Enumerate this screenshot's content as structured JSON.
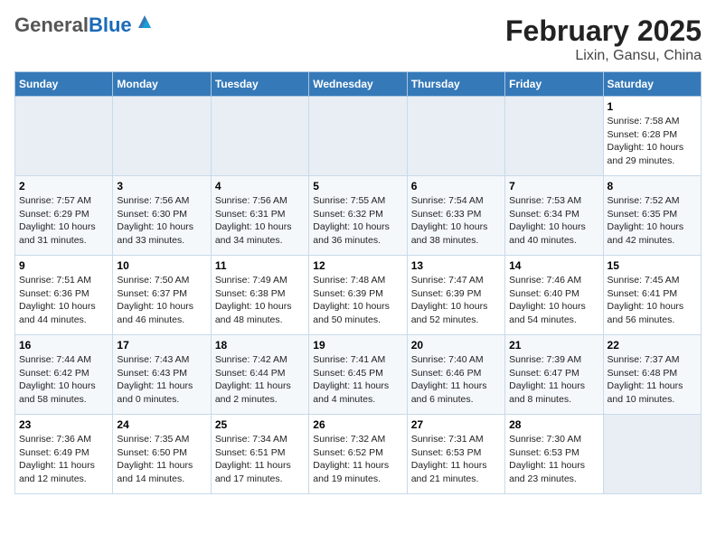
{
  "logo": {
    "general": "General",
    "blue": "Blue"
  },
  "title": "February 2025",
  "subtitle": "Lixin, Gansu, China",
  "days_of_week": [
    "Sunday",
    "Monday",
    "Tuesday",
    "Wednesday",
    "Thursday",
    "Friday",
    "Saturday"
  ],
  "weeks": [
    [
      {
        "day": "",
        "info": ""
      },
      {
        "day": "",
        "info": ""
      },
      {
        "day": "",
        "info": ""
      },
      {
        "day": "",
        "info": ""
      },
      {
        "day": "",
        "info": ""
      },
      {
        "day": "",
        "info": ""
      },
      {
        "day": "1",
        "info": "Sunrise: 7:58 AM\nSunset: 6:28 PM\nDaylight: 10 hours and 29 minutes."
      }
    ],
    [
      {
        "day": "2",
        "info": "Sunrise: 7:57 AM\nSunset: 6:29 PM\nDaylight: 10 hours and 31 minutes."
      },
      {
        "day": "3",
        "info": "Sunrise: 7:56 AM\nSunset: 6:30 PM\nDaylight: 10 hours and 33 minutes."
      },
      {
        "day": "4",
        "info": "Sunrise: 7:56 AM\nSunset: 6:31 PM\nDaylight: 10 hours and 34 minutes."
      },
      {
        "day": "5",
        "info": "Sunrise: 7:55 AM\nSunset: 6:32 PM\nDaylight: 10 hours and 36 minutes."
      },
      {
        "day": "6",
        "info": "Sunrise: 7:54 AM\nSunset: 6:33 PM\nDaylight: 10 hours and 38 minutes."
      },
      {
        "day": "7",
        "info": "Sunrise: 7:53 AM\nSunset: 6:34 PM\nDaylight: 10 hours and 40 minutes."
      },
      {
        "day": "8",
        "info": "Sunrise: 7:52 AM\nSunset: 6:35 PM\nDaylight: 10 hours and 42 minutes."
      }
    ],
    [
      {
        "day": "9",
        "info": "Sunrise: 7:51 AM\nSunset: 6:36 PM\nDaylight: 10 hours and 44 minutes."
      },
      {
        "day": "10",
        "info": "Sunrise: 7:50 AM\nSunset: 6:37 PM\nDaylight: 10 hours and 46 minutes."
      },
      {
        "day": "11",
        "info": "Sunrise: 7:49 AM\nSunset: 6:38 PM\nDaylight: 10 hours and 48 minutes."
      },
      {
        "day": "12",
        "info": "Sunrise: 7:48 AM\nSunset: 6:39 PM\nDaylight: 10 hours and 50 minutes."
      },
      {
        "day": "13",
        "info": "Sunrise: 7:47 AM\nSunset: 6:39 PM\nDaylight: 10 hours and 52 minutes."
      },
      {
        "day": "14",
        "info": "Sunrise: 7:46 AM\nSunset: 6:40 PM\nDaylight: 10 hours and 54 minutes."
      },
      {
        "day": "15",
        "info": "Sunrise: 7:45 AM\nSunset: 6:41 PM\nDaylight: 10 hours and 56 minutes."
      }
    ],
    [
      {
        "day": "16",
        "info": "Sunrise: 7:44 AM\nSunset: 6:42 PM\nDaylight: 10 hours and 58 minutes."
      },
      {
        "day": "17",
        "info": "Sunrise: 7:43 AM\nSunset: 6:43 PM\nDaylight: 11 hours and 0 minutes."
      },
      {
        "day": "18",
        "info": "Sunrise: 7:42 AM\nSunset: 6:44 PM\nDaylight: 11 hours and 2 minutes."
      },
      {
        "day": "19",
        "info": "Sunrise: 7:41 AM\nSunset: 6:45 PM\nDaylight: 11 hours and 4 minutes."
      },
      {
        "day": "20",
        "info": "Sunrise: 7:40 AM\nSunset: 6:46 PM\nDaylight: 11 hours and 6 minutes."
      },
      {
        "day": "21",
        "info": "Sunrise: 7:39 AM\nSunset: 6:47 PM\nDaylight: 11 hours and 8 minutes."
      },
      {
        "day": "22",
        "info": "Sunrise: 7:37 AM\nSunset: 6:48 PM\nDaylight: 11 hours and 10 minutes."
      }
    ],
    [
      {
        "day": "23",
        "info": "Sunrise: 7:36 AM\nSunset: 6:49 PM\nDaylight: 11 hours and 12 minutes."
      },
      {
        "day": "24",
        "info": "Sunrise: 7:35 AM\nSunset: 6:50 PM\nDaylight: 11 hours and 14 minutes."
      },
      {
        "day": "25",
        "info": "Sunrise: 7:34 AM\nSunset: 6:51 PM\nDaylight: 11 hours and 17 minutes."
      },
      {
        "day": "26",
        "info": "Sunrise: 7:32 AM\nSunset: 6:52 PM\nDaylight: 11 hours and 19 minutes."
      },
      {
        "day": "27",
        "info": "Sunrise: 7:31 AM\nSunset: 6:53 PM\nDaylight: 11 hours and 21 minutes."
      },
      {
        "day": "28",
        "info": "Sunrise: 7:30 AM\nSunset: 6:53 PM\nDaylight: 11 hours and 23 minutes."
      },
      {
        "day": "",
        "info": ""
      }
    ]
  ]
}
